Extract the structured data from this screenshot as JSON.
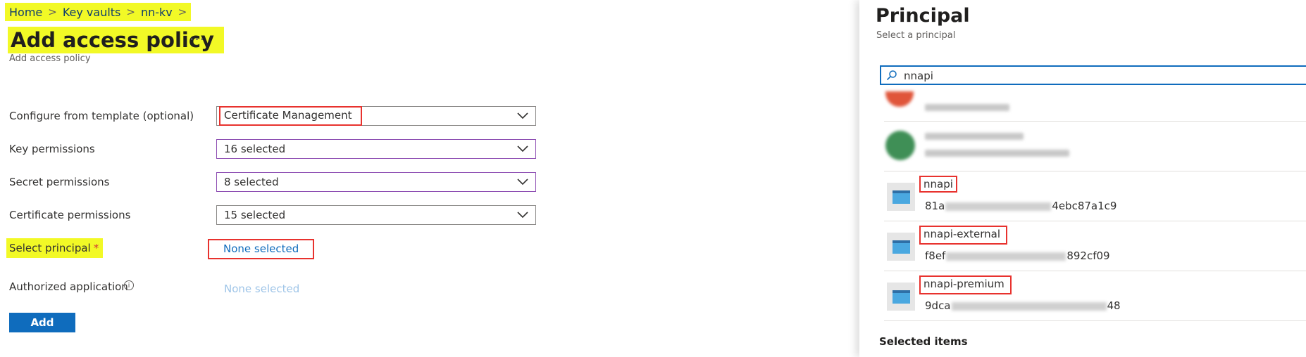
{
  "breadcrumb": {
    "items": [
      "Home",
      "Key vaults",
      "nn-kv"
    ],
    "separator": ">"
  },
  "page": {
    "title": "Add access policy",
    "more": "···",
    "subtitle": "Add access policy"
  },
  "form": {
    "template": {
      "label": "Configure from template (optional)",
      "value": "Certificate Management"
    },
    "key_permissions": {
      "label": "Key permissions",
      "value": "16 selected"
    },
    "secret_permissions": {
      "label": "Secret permissions",
      "value": "8 selected"
    },
    "certificate_permissions": {
      "label": "Certificate permissions",
      "value": "15 selected"
    },
    "principal": {
      "label": "Select principal",
      "required_mark": "*",
      "value": "None selected"
    },
    "authorized_app": {
      "label": "Authorized application",
      "info": "i",
      "value": "None selected"
    },
    "add_button": "Add"
  },
  "panel": {
    "title": "Principal",
    "subtitle": "Select a principal",
    "search_value": "nnapi",
    "results": [
      {
        "name": "nnapi",
        "id_start": "81a",
        "id_end": "4ebc87a1c9"
      },
      {
        "name": "nnapi-external",
        "id_start": "f8ef",
        "id_end": "892cf09"
      },
      {
        "name": "nnapi-premium",
        "id_start": "9dca",
        "id_end": "48"
      }
    ],
    "selected_items_label": "Selected items"
  },
  "colors": {
    "highlight": "#f2f926",
    "annotation_red": "#e8322e",
    "accent": "#0f6cbd"
  }
}
